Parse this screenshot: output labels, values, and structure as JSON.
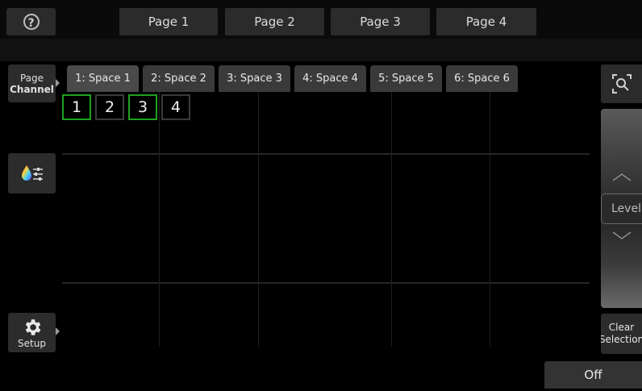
{
  "topbar": {
    "help_icon": "?",
    "pages": [
      {
        "label": "Page 1"
      },
      {
        "label": "Page 2"
      },
      {
        "label": "Page 3"
      },
      {
        "label": "Page 4"
      }
    ]
  },
  "sidebar": {
    "page_line1": "Page",
    "page_line2": "Channel",
    "color_icon": "color-palette-icon",
    "setup_label": "Setup"
  },
  "tabs": [
    {
      "label": "1: Space 1",
      "active": true
    },
    {
      "label": "2: Space 2"
    },
    {
      "label": "3: Space 3"
    },
    {
      "label": "4: Space 4"
    },
    {
      "label": "5: Space 5"
    },
    {
      "label": "6: Space 6"
    }
  ],
  "fixtures": [
    {
      "label": "1",
      "selected": true
    },
    {
      "label": "2",
      "selected": false
    },
    {
      "label": "3",
      "selected": true
    },
    {
      "label": "4",
      "selected": false
    }
  ],
  "right": {
    "level_label": "Level",
    "clear_line1": "Clear",
    "clear_line2": "Selection",
    "off_label": "Off"
  },
  "colors": {
    "selected_border": "#1fa11f",
    "button_bg": "#2b2b2b",
    "background": "#000000"
  }
}
